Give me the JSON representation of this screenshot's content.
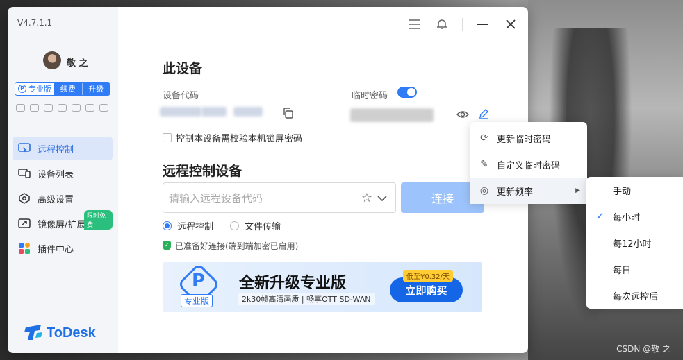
{
  "app": {
    "version": "V4.7.1.1",
    "username": "敬 之",
    "plan": {
      "pro_label": "专业版",
      "renew_label": "续费",
      "upgrade_label": "升级"
    },
    "brand": "ToDesk"
  },
  "sidebar": {
    "items": [
      {
        "label": "远程控制",
        "icon": "remote-control-icon",
        "active": true
      },
      {
        "label": "设备列表",
        "icon": "device-list-icon",
        "active": false
      },
      {
        "label": "高级设置",
        "icon": "settings-hex-icon",
        "active": false
      },
      {
        "label": "镜像屏/扩展屏",
        "icon": "mirror-screen-icon",
        "active": false,
        "badge": "限时免费"
      },
      {
        "label": "插件中心",
        "icon": "plugin-grid-icon",
        "active": false
      }
    ]
  },
  "this_device": {
    "title": "此设备",
    "code_label": "设备代码",
    "temp_password_label": "临时密码",
    "temp_password_enabled": true,
    "lock_checkbox_label": "控制本设备需校验本机锁屏密码"
  },
  "remote": {
    "title": "远程控制设备",
    "input_placeholder": "请输入远程设备代码",
    "connect_label": "连接",
    "mode_remote": "远程控制",
    "mode_file": "文件传输",
    "status": "已准备好连接(端到端加密已启用)"
  },
  "banner": {
    "badge": "专业版",
    "title": "全新升级专业版",
    "subtitle": "2k30帧高清画质 | 畅享OTT SD-WAN",
    "price_tag": "低至¥0.32/天",
    "buy_label": "立即购买"
  },
  "context_menu": {
    "items": [
      {
        "label": "更新临时密码",
        "icon": "refresh-icon"
      },
      {
        "label": "自定义临时密码",
        "icon": "edit-icon"
      },
      {
        "label": "更新频率",
        "icon": "frequency-icon",
        "has_submenu": true
      }
    ]
  },
  "frequency_menu": {
    "items": [
      {
        "label": "手动",
        "checked": false
      },
      {
        "label": "每小时",
        "checked": true
      },
      {
        "label": "每12小时",
        "checked": false
      },
      {
        "label": "每日",
        "checked": false
      },
      {
        "label": "每次远控后",
        "checked": false
      }
    ]
  },
  "watermark": "CSDN @敬 之",
  "colors": {
    "accent": "#2f7cf6",
    "active_bg": "#dbe6fb",
    "buy": "#1566e6",
    "badge_green": "#2bbf7e"
  }
}
